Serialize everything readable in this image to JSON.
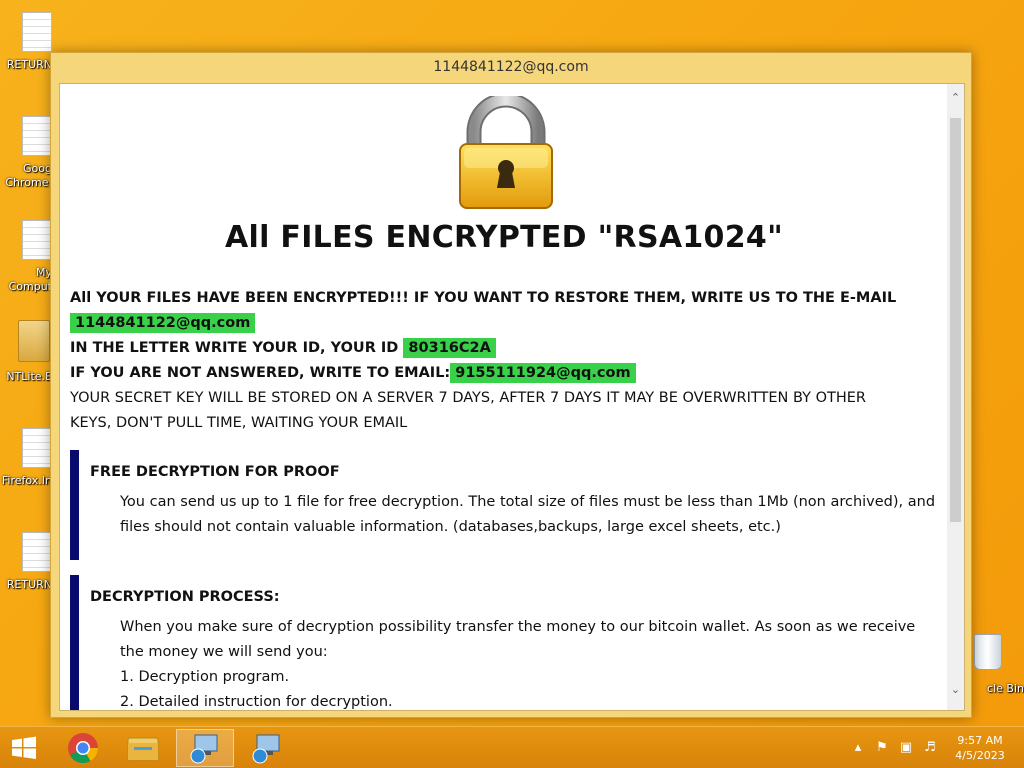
{
  "desktop": {
    "icons": [
      {
        "label": "RETURN"
      },
      {
        "label": "Goog\nChrome."
      },
      {
        "label": "My\nComput"
      },
      {
        "label": "NTLite.E"
      },
      {
        "label": "Firefox.In"
      },
      {
        "label": "RETURN"
      }
    ],
    "recycle_bin_label": "cle Bin"
  },
  "window": {
    "title": "1144841122@qq.com",
    "heading": "All FILES ENCRYPTED \"RSA1024\"",
    "line1": "All YOUR FILES HAVE BEEN ENCRYPTED!!! IF YOU WANT TO RESTORE THEM, WRITE US TO THE E-MAIL",
    "email1": "1144841122@qq.com",
    "line2": "IN THE LETTER WRITE YOUR ID, YOUR ID",
    "id": "80316C2A",
    "line3": "IF YOU ARE NOT ANSWERED, WRITE TO EMAIL:",
    "email2": "9155111924@qq.com",
    "line4": "YOUR SECRET KEY WILL BE STORED ON A SERVER 7 DAYS, AFTER 7 DAYS IT MAY BE OVERWRITTEN BY OTHER KEYS, DON'T PULL TIME, WAITING YOUR EMAIL",
    "section1": {
      "heading": "FREE DECRYPTION FOR PROOF",
      "text": "You can send us up to 1 file for free decryption. The total size of files must be less than 1Mb (non archived), and files should not contain valuable information. (databases,backups, large excel sheets, etc.)"
    },
    "section2": {
      "heading": "DECRYPTION PROCESS:",
      "text": "When you make sure of decryption possibility transfer the money to our bitcoin wallet. As soon as we receive the money we will send you:",
      "item1": "1. Decryption program.",
      "item2": "2. Detailed instruction for decryption."
    }
  },
  "taskbar": {
    "time": "9:57 AM",
    "date": "4/5/2023"
  },
  "colors": {
    "highlight": "#3ad14a",
    "section_bar": "#080a6e",
    "desktop": "#f6a610"
  }
}
